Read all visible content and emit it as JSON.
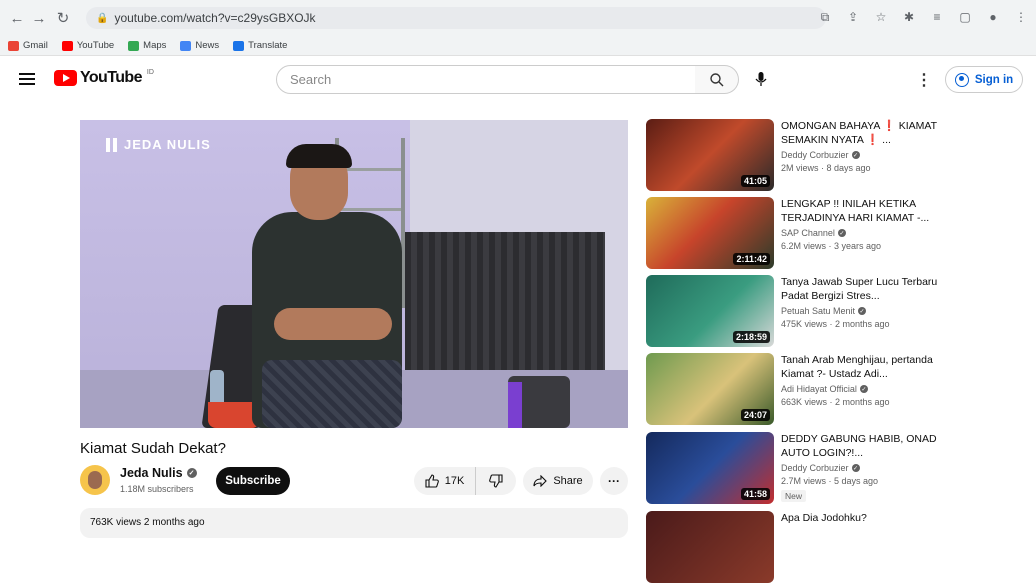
{
  "browser": {
    "url": "youtube.com/watch?v=c29ysGBXOJk",
    "bookmarks": [
      "Gmail",
      "YouTube",
      "Maps",
      "News",
      "Translate"
    ]
  },
  "header": {
    "logo_text": "YouTube",
    "logo_sup": "ID",
    "search_placeholder": "Search",
    "signin_label": "Sign in"
  },
  "player": {
    "watermark": "JEDA NULIS"
  },
  "video": {
    "title": "Kiamat Sudah Dekat?",
    "channel": "Jeda Nulis",
    "subscribers": "1.18M subscribers",
    "subscribe_label": "Subscribe",
    "likes": "17K",
    "share_label": "Share",
    "views_line": "763K views  2 months ago"
  },
  "recommendations": [
    {
      "title": "OMONGAN BAHAYA ❗ KIAMAT SEMAKIN NYATA ❗ ...",
      "channel": "Deddy Corbuzier",
      "meta": "2M views · 8 days ago",
      "duration": "41:05",
      "thumb_color": "#a33a2a"
    },
    {
      "title": "LENGKAP !! INILAH KETIKA TERJADINYA HARI KIAMAT -...",
      "channel": "SAP Channel",
      "meta": "6.2M views · 3 years ago",
      "duration": "2:11:42",
      "thumb_color": "#c7442b"
    },
    {
      "title": "Tanya Jawab Super Lucu Terbaru Padat Bergizi Stres...",
      "channel": "Petuah Satu Menit",
      "meta": "475K views · 2 months ago",
      "duration": "2:18:59",
      "thumb_color": "#2d7d6a"
    },
    {
      "title": "Tanah Arab Menghijau, pertanda Kiamat ?- Ustadz Adi...",
      "channel": "Adi Hidayat Official",
      "meta": "663K views · 2 months ago",
      "duration": "24:07",
      "thumb_color": "#5f8a45"
    },
    {
      "title": "DEDDY GABUNG HABIB, ONAD AUTO LOGIN?!...",
      "channel": "Deddy Corbuzier",
      "meta": "2.7M views · 5 days ago",
      "badge": "New",
      "duration": "41:58",
      "thumb_color": "#1e3a78"
    },
    {
      "title": "Apa Dia Jodohku?",
      "channel": "",
      "meta": "",
      "duration": "",
      "thumb_color": "#6b2a2a"
    }
  ]
}
